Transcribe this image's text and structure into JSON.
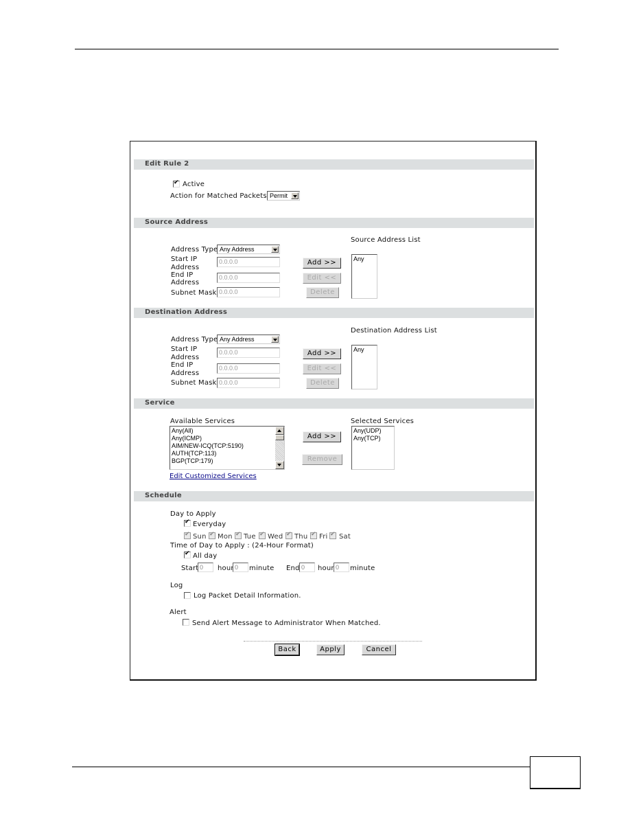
{
  "form": {
    "edit_rule": {
      "header": "Edit Rule 2",
      "active_label": "Active",
      "active_checked": true,
      "action_label": "Action for Matched Packets:",
      "action_value": "Permit"
    },
    "source": {
      "header": "Source Address",
      "address_type_label": "Address Type",
      "address_type_value": "Any Address",
      "start_ip_label_1": "Start IP",
      "start_ip_label_2": "Address",
      "start_ip_value": "0.0.0.0",
      "end_ip_label_1": "End IP",
      "end_ip_label_2": "Address",
      "end_ip_value": "0.0.0.0",
      "subnet_label": "Subnet Mask",
      "subnet_value": "0.0.0.0",
      "add_button": "Add >>",
      "edit_button": "Edit <<",
      "delete_button": "Delete",
      "list_label": "Source Address List",
      "list_items": [
        "Any"
      ]
    },
    "destination": {
      "header": "Destination Address",
      "address_type_label": "Address Type",
      "address_type_value": "Any Address",
      "start_ip_label_1": "Start IP",
      "start_ip_label_2": "Address",
      "start_ip_value": "0.0.0.0",
      "end_ip_label_1": "End IP",
      "end_ip_label_2": "Address",
      "end_ip_value": "0.0.0.0",
      "subnet_label": "Subnet Mask",
      "subnet_value": "0.0.0.0",
      "add_button": "Add >>",
      "edit_button": "Edit <<",
      "delete_button": "Delete",
      "list_label": "Destination Address List",
      "list_items": [
        "Any"
      ]
    },
    "service": {
      "header": "Service",
      "available_label": "Available Services",
      "available_items": [
        "Any(All)",
        "Any(ICMP)",
        "AIM/NEW-ICQ(TCP:5190)",
        "AUTH(TCP:113)",
        "BGP(TCP:179)"
      ],
      "add_button": "Add >>",
      "remove_button": "Remove",
      "selected_label": "Selected Services",
      "selected_items": [
        "Any(UDP)",
        "Any(TCP)"
      ],
      "edit_link": "Edit Customized Services"
    },
    "schedule": {
      "header": "Schedule",
      "day_label": "Day to Apply",
      "everyday_label": "Everyday",
      "everyday_checked": true,
      "days": [
        {
          "label": "Sun",
          "checked": true
        },
        {
          "label": "Mon",
          "checked": true
        },
        {
          "label": "Tue",
          "checked": true
        },
        {
          "label": "Wed",
          "checked": true
        },
        {
          "label": "Thu",
          "checked": true
        },
        {
          "label": "Fri",
          "checked": true
        },
        {
          "label": "Sat",
          "checked": true
        }
      ],
      "time_label": "Time of Day to Apply : (24-Hour Format)",
      "allday_label": "All day",
      "allday_checked": true,
      "start_label": "Start",
      "end_label": "End",
      "hour_label": "hour",
      "minute_label": "minute",
      "start_hour": "0",
      "start_minute": "0",
      "end_hour": "0",
      "end_minute": "0"
    },
    "log": {
      "label": "Log",
      "option_label": "Log Packet Detail Information.",
      "checked": false
    },
    "alert": {
      "label": "Alert",
      "option_label": "Send Alert Message to Administrator When Matched.",
      "checked": false
    },
    "buttons": {
      "back": "Back",
      "apply": "Apply",
      "cancel": "Cancel"
    }
  }
}
